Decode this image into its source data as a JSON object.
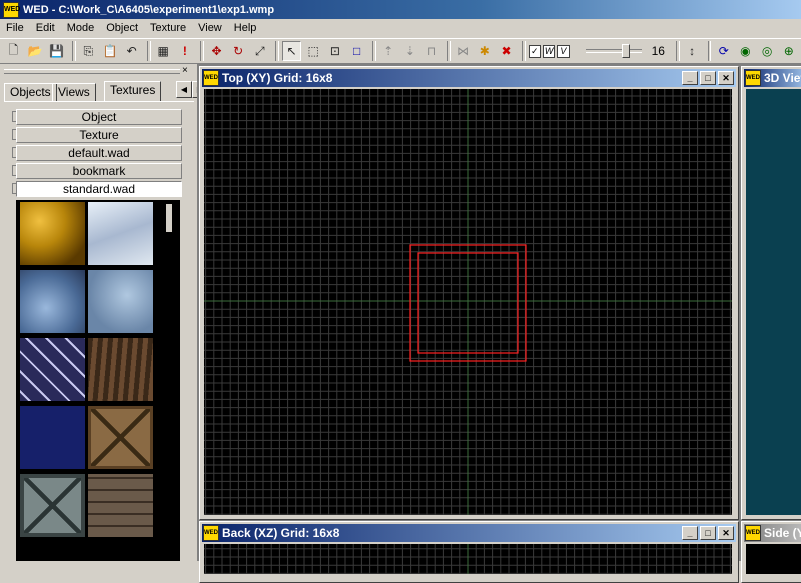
{
  "window": {
    "title": "WED - C:\\Work_C\\A6405\\experiment1\\exp1.wmp",
    "app_icon": "WED"
  },
  "menu": [
    "File",
    "Edit",
    "Mode",
    "Object",
    "Texture",
    "View",
    "Help"
  ],
  "toolbar": {
    "slider_value": "16",
    "check_labels": [
      "W",
      "V"
    ]
  },
  "left_panel": {
    "tabs": [
      "Objects",
      "Views",
      "Textures"
    ],
    "active_tab": "Textures",
    "groups": [
      "Object",
      "Texture",
      "default.wad",
      "bookmark",
      "standard.wad"
    ],
    "textures": [
      {
        "name": "gold",
        "color": "#b8860b"
      },
      {
        "name": "ice",
        "color": "#b8c8dc"
      },
      {
        "name": "blue-marble",
        "color": "#5a7aa6"
      },
      {
        "name": "blue-rock",
        "color": "#7a96b8"
      },
      {
        "name": "white-vein",
        "color": "#3a3a6a"
      },
      {
        "name": "bark",
        "color": "#5a3e28"
      },
      {
        "name": "navy",
        "color": "#16206a"
      },
      {
        "name": "crate",
        "color": "#8a6a44"
      },
      {
        "name": "metal-crate",
        "color": "#6a7878"
      },
      {
        "name": "stone-brick",
        "color": "#6a5a4a"
      }
    ]
  },
  "views": {
    "top": {
      "title": "Top (XY) Grid: 16x8"
    },
    "back": {
      "title": "Back (XZ) Grid: 16x8"
    },
    "three_d": {
      "title": "3D View"
    },
    "side": {
      "title": "Side (Y"
    }
  },
  "colors": {
    "grid_bg": "#000000",
    "grid_line": "#3a3a3a",
    "axis": "#3d6e3d",
    "selection": "#ff2020",
    "viewport_3d": "#0a4050"
  }
}
